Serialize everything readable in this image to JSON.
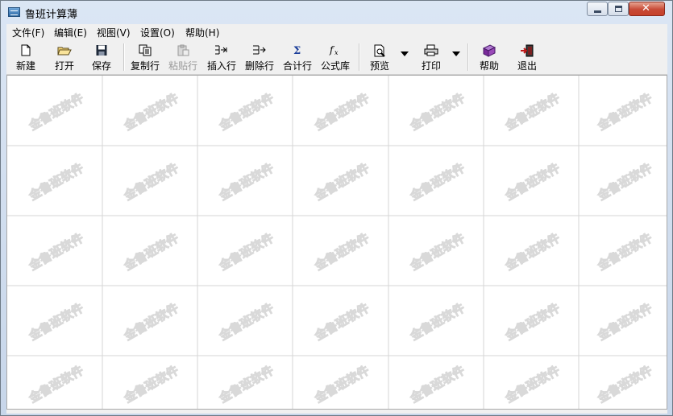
{
  "window": {
    "title": "鲁班计算薄"
  },
  "titlebar_buttons": {
    "minimize": "minimize",
    "maximize": "maximize",
    "close": "close"
  },
  "menu": [
    {
      "label": "文件(F)"
    },
    {
      "label": "编辑(E)"
    },
    {
      "label": "视图(V)"
    },
    {
      "label": "设置(O)"
    },
    {
      "label": "帮助(H)"
    }
  ],
  "toolbar": {
    "new": "新建",
    "open": "打开",
    "save": "保存",
    "copy_row": "复制行",
    "paste_row": "粘贴行",
    "insert_row": "插入行",
    "delete_row": "删除行",
    "sum_row": "合计行",
    "formula_lib": "公式库",
    "preview": "预览",
    "print": "打印",
    "help": "帮助",
    "exit": "退出"
  },
  "watermark": {
    "text": "金鲁班软件",
    "color": "#d9d9d9"
  },
  "colors": {
    "accent": "#2d6aa6",
    "close": "#c74a36",
    "grid_line": "#d6d6d6"
  }
}
